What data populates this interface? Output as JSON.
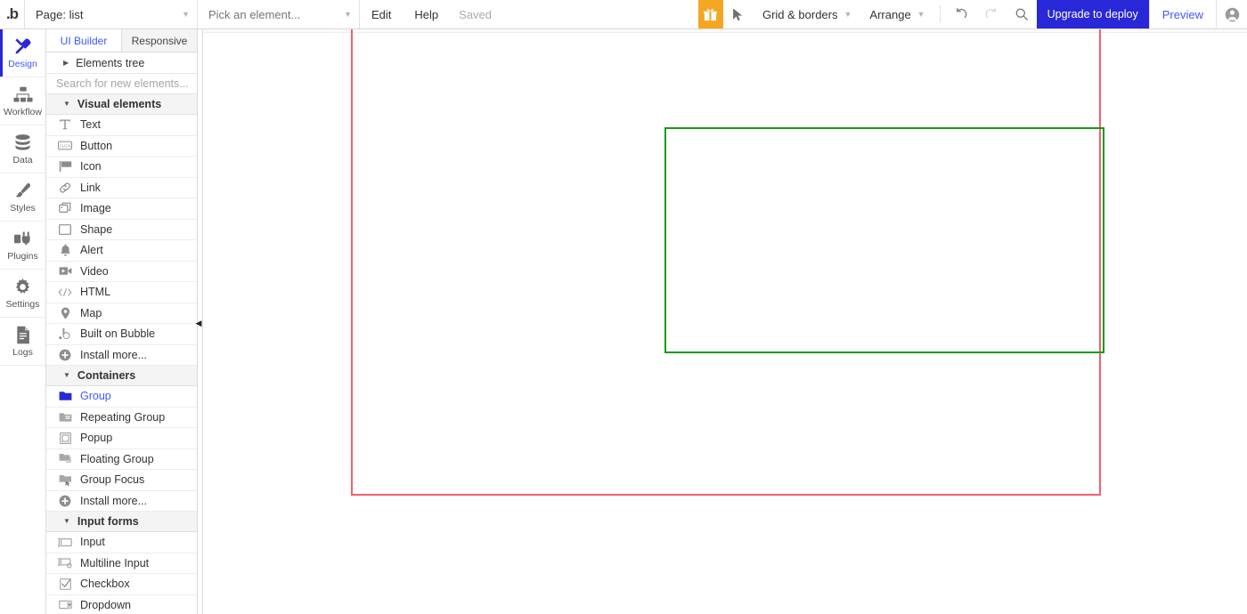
{
  "topbar": {
    "logo": ".b",
    "page_select": {
      "label": "Page: list",
      "icon": "chevron-down-icon"
    },
    "element_select": {
      "placeholder": "Pick an element...",
      "icon": "chevron-down-icon"
    },
    "menus": [
      {
        "label": "Edit",
        "name": "edit"
      },
      {
        "label": "Help",
        "name": "help"
      }
    ],
    "save_status": "Saved",
    "gift_icon": "gift-icon",
    "pointer_icon": "cursor-pointer-icon",
    "grid_borders": {
      "label": "Grid & borders",
      "icon": "chevron-down-icon"
    },
    "arrange": {
      "label": "Arrange",
      "icon": "chevron-down-icon"
    },
    "undo_icon": "undo-icon",
    "redo_icon": "redo-icon",
    "search_icon": "search-icon",
    "upgrade_label": "Upgrade to deploy",
    "preview_label": "Preview",
    "avatar_icon": "user-avatar-icon",
    "accent_blue": "#3d5afe",
    "upgrade_bg": "#2828d8",
    "gift_bg": "#f5a623"
  },
  "rail": {
    "items": [
      {
        "label": "Design",
        "icon": "design-tools-icon",
        "active": true
      },
      {
        "label": "Workflow",
        "icon": "workflow-icon",
        "active": false
      },
      {
        "label": "Data",
        "icon": "database-icon",
        "active": false
      },
      {
        "label": "Styles",
        "icon": "paintbrush-icon",
        "active": false
      },
      {
        "label": "Plugins",
        "icon": "plugins-icon",
        "active": false
      },
      {
        "label": "Settings",
        "icon": "gear-icon",
        "active": false
      },
      {
        "label": "Logs",
        "icon": "document-logs-icon",
        "active": false
      }
    ]
  },
  "panel": {
    "tabs": [
      {
        "label": "UI Builder",
        "active": true
      },
      {
        "label": "Responsive",
        "active": false
      }
    ],
    "elements_tree": {
      "label": "Elements tree",
      "expanded": false
    },
    "search_placeholder": "Search for new elements...",
    "sections": [
      {
        "label": "Visual elements",
        "expanded": true,
        "items": [
          {
            "label": "Text",
            "icon": "text-t-icon",
            "selected": false
          },
          {
            "label": "Button",
            "icon": "button-click-icon",
            "selected": false
          },
          {
            "label": "Icon",
            "icon": "flag-icon",
            "selected": false
          },
          {
            "label": "Link",
            "icon": "link-chain-icon",
            "selected": false
          },
          {
            "label": "Image",
            "icon": "image-icon",
            "selected": false
          },
          {
            "label": "Shape",
            "icon": "square-shape-icon",
            "selected": false
          },
          {
            "label": "Alert",
            "icon": "bell-alert-icon",
            "selected": false
          },
          {
            "label": "Video",
            "icon": "video-camera-icon",
            "selected": false
          },
          {
            "label": "HTML",
            "icon": "code-html-icon",
            "selected": false
          },
          {
            "label": "Map",
            "icon": "map-pin-icon",
            "selected": false
          },
          {
            "label": "Built on Bubble",
            "icon": "bubble-logo-icon",
            "selected": false
          },
          {
            "label": "Install more...",
            "icon": "plus-circle-icon",
            "selected": false
          }
        ]
      },
      {
        "label": "Containers",
        "expanded": true,
        "items": [
          {
            "label": "Group",
            "icon": "folder-group-icon",
            "selected": true
          },
          {
            "label": "Repeating Group",
            "icon": "repeating-group-icon",
            "selected": false
          },
          {
            "label": "Popup",
            "icon": "popup-icon",
            "selected": false
          },
          {
            "label": "Floating Group",
            "icon": "floating-group-icon",
            "selected": false
          },
          {
            "label": "Group Focus",
            "icon": "group-focus-icon",
            "selected": false
          },
          {
            "label": "Install more...",
            "icon": "plus-circle-icon",
            "selected": false
          }
        ]
      },
      {
        "label": "Input forms",
        "expanded": true,
        "items": [
          {
            "label": "Input",
            "icon": "input-field-icon",
            "selected": false
          },
          {
            "label": "Multiline Input",
            "icon": "multiline-input-icon",
            "selected": false
          },
          {
            "label": "Checkbox",
            "icon": "checkbox-icon",
            "selected": false
          },
          {
            "label": "Dropdown",
            "icon": "dropdown-icon",
            "selected": false
          }
        ]
      }
    ],
    "collapse_icon": "collapse-panel-left-icon"
  },
  "canvas": {
    "page_border_color": "#f4606c",
    "group_border_color": "#169b16"
  }
}
